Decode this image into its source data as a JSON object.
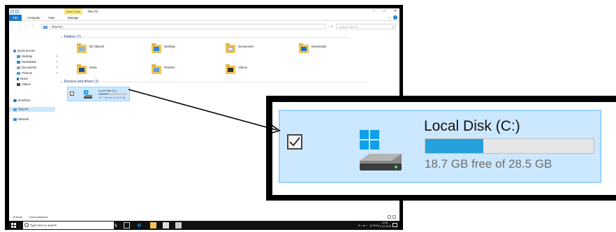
{
  "window": {
    "title": "This PC",
    "context_tab": "Drive Tools",
    "controls": [
      "–",
      "□",
      "✕"
    ]
  },
  "ribbon": {
    "tabs": [
      "File",
      "Computer",
      "View",
      "Manage"
    ],
    "help": "?"
  },
  "address": {
    "back": "←",
    "forward": "→",
    "up": "↑",
    "path": "This PC",
    "search_placeholder": "Search This PC"
  },
  "navpane": {
    "quick_access": "Quick access",
    "pinned": [
      "Desktop",
      "Downloads",
      "Documents",
      "Pictures"
    ],
    "unpinned": [
      "Music",
      "Videos"
    ],
    "onedrive": "OneDrive",
    "this_pc": "This PC",
    "network": "Network"
  },
  "content": {
    "folders_header": "Folders (7)",
    "folders": [
      "3D Objects",
      "Desktop",
      "Documents",
      "Downloads",
      "Music",
      "Pictures",
      "Videos"
    ],
    "drives_header": "Devices and drives (1)",
    "drive": {
      "name": "Local Disk (C:)",
      "free_text": "18.7 GB free of 28.5 GB",
      "used_fraction": 0.344
    }
  },
  "statusbar": {
    "items_count": "8 items",
    "selected": "1 item selected"
  },
  "taskbar": {
    "search_text": "Type here to search",
    "tray_lang": "ENG",
    "time": "11:58",
    "date": "17-04-2018"
  },
  "zoom": {
    "drive_name": "Local Disk (C:)",
    "free_text": "18.7 GB free of 28.5 GB",
    "used_fraction": 0.344
  },
  "colors": {
    "accent": "#1979ca",
    "selection": "#cce8ff",
    "progress": "#26a0da",
    "folder": "#f0c453"
  }
}
